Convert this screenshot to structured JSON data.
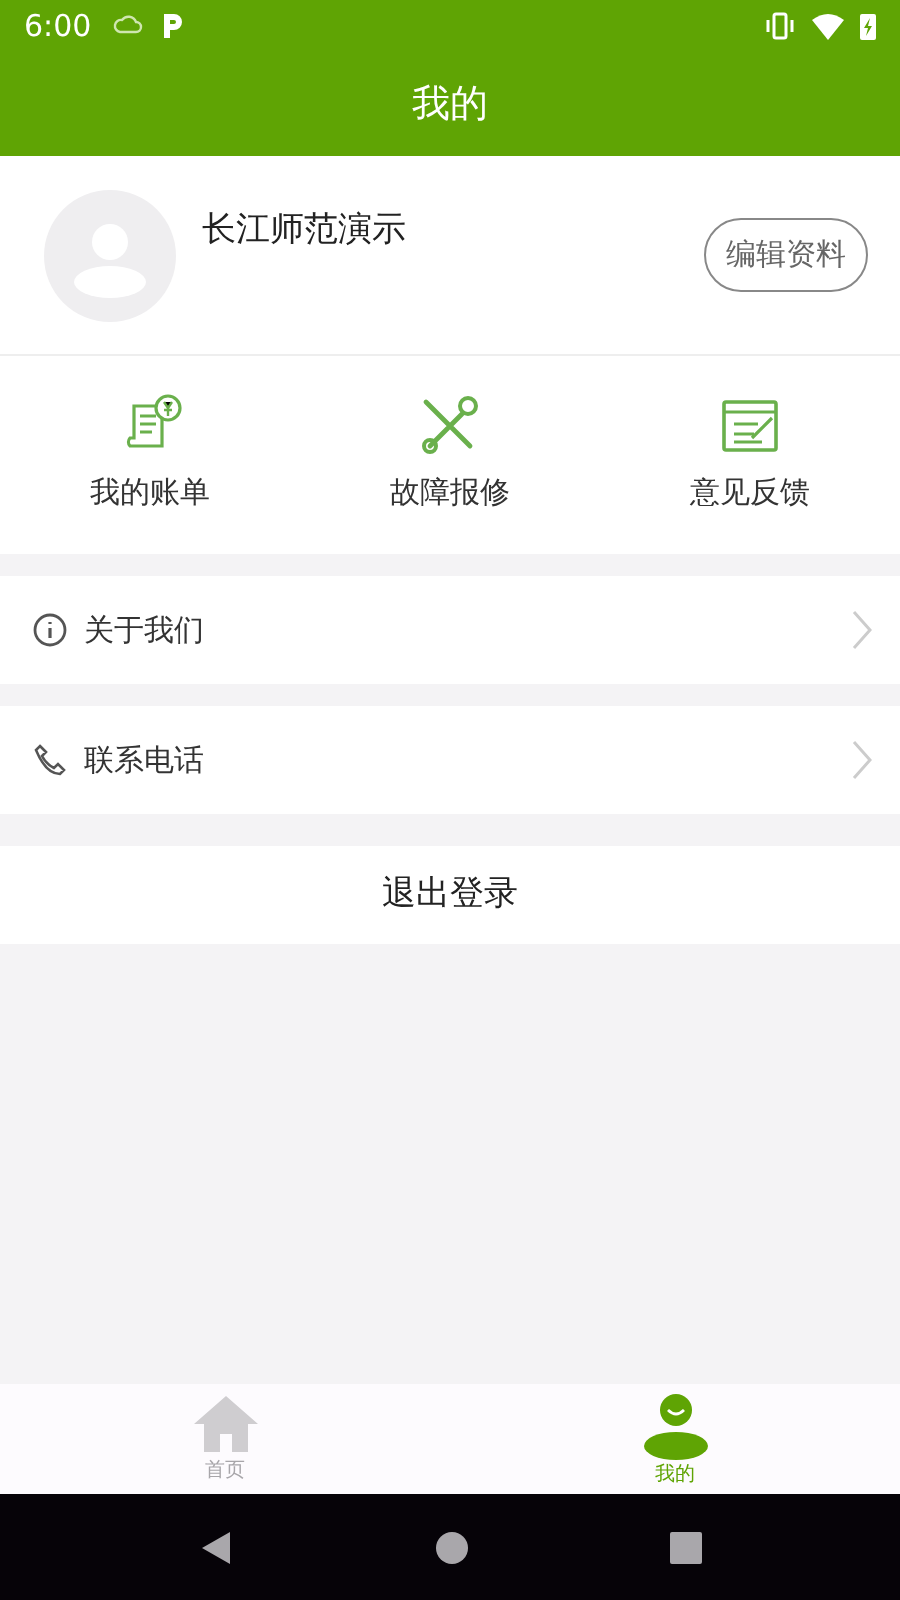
{
  "status_bar": {
    "time": "6:00"
  },
  "header": {
    "title": "我的"
  },
  "profile": {
    "name": "长江师范演示",
    "edit_button": "编辑资料"
  },
  "shortcuts": [
    {
      "label": "我的账单"
    },
    {
      "label": "故障报修"
    },
    {
      "label": "意见反馈"
    }
  ],
  "menu": [
    {
      "label": "关于我们"
    },
    {
      "label": "联系电话"
    }
  ],
  "logout_button": "退出登录",
  "tabs": [
    {
      "label": "首页",
      "selected": false
    },
    {
      "label": "我的",
      "selected": true
    }
  ]
}
